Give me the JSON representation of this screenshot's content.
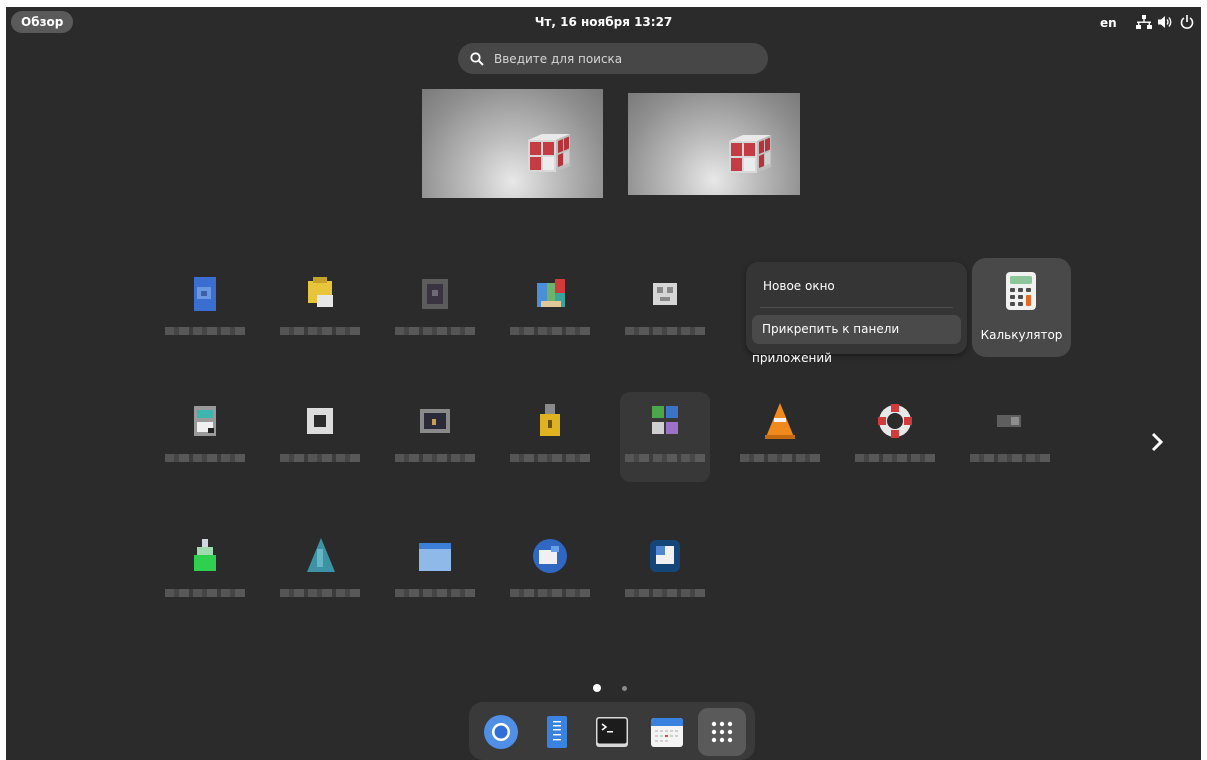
{
  "topbar": {
    "activities_label": "Обзор",
    "clock": "Чт, 16 ноября  13:27",
    "language": "en",
    "tray_icons": [
      "network-icon",
      "volume-icon",
      "power-icon"
    ]
  },
  "search": {
    "placeholder": "Введите для поиска"
  },
  "workspaces": [
    {
      "name": "workspace-1"
    },
    {
      "name": "workspace-2"
    }
  ],
  "context_menu": {
    "items": [
      "Новое окно",
      "Прикрепить к панели приложений"
    ]
  },
  "selected_app": {
    "label": "Калькулятор",
    "icon": "calculator-icon"
  },
  "app_grid": {
    "pages_total": 2,
    "current_page": 1
  },
  "dock": {
    "items": [
      "chromium-icon",
      "text-editor-icon",
      "terminal-icon",
      "calendar-icon",
      "show-apps-icon"
    ]
  },
  "colors": {
    "background": "#2b2b2b",
    "panel": "#353535",
    "highlight": "#4a4a4a"
  }
}
